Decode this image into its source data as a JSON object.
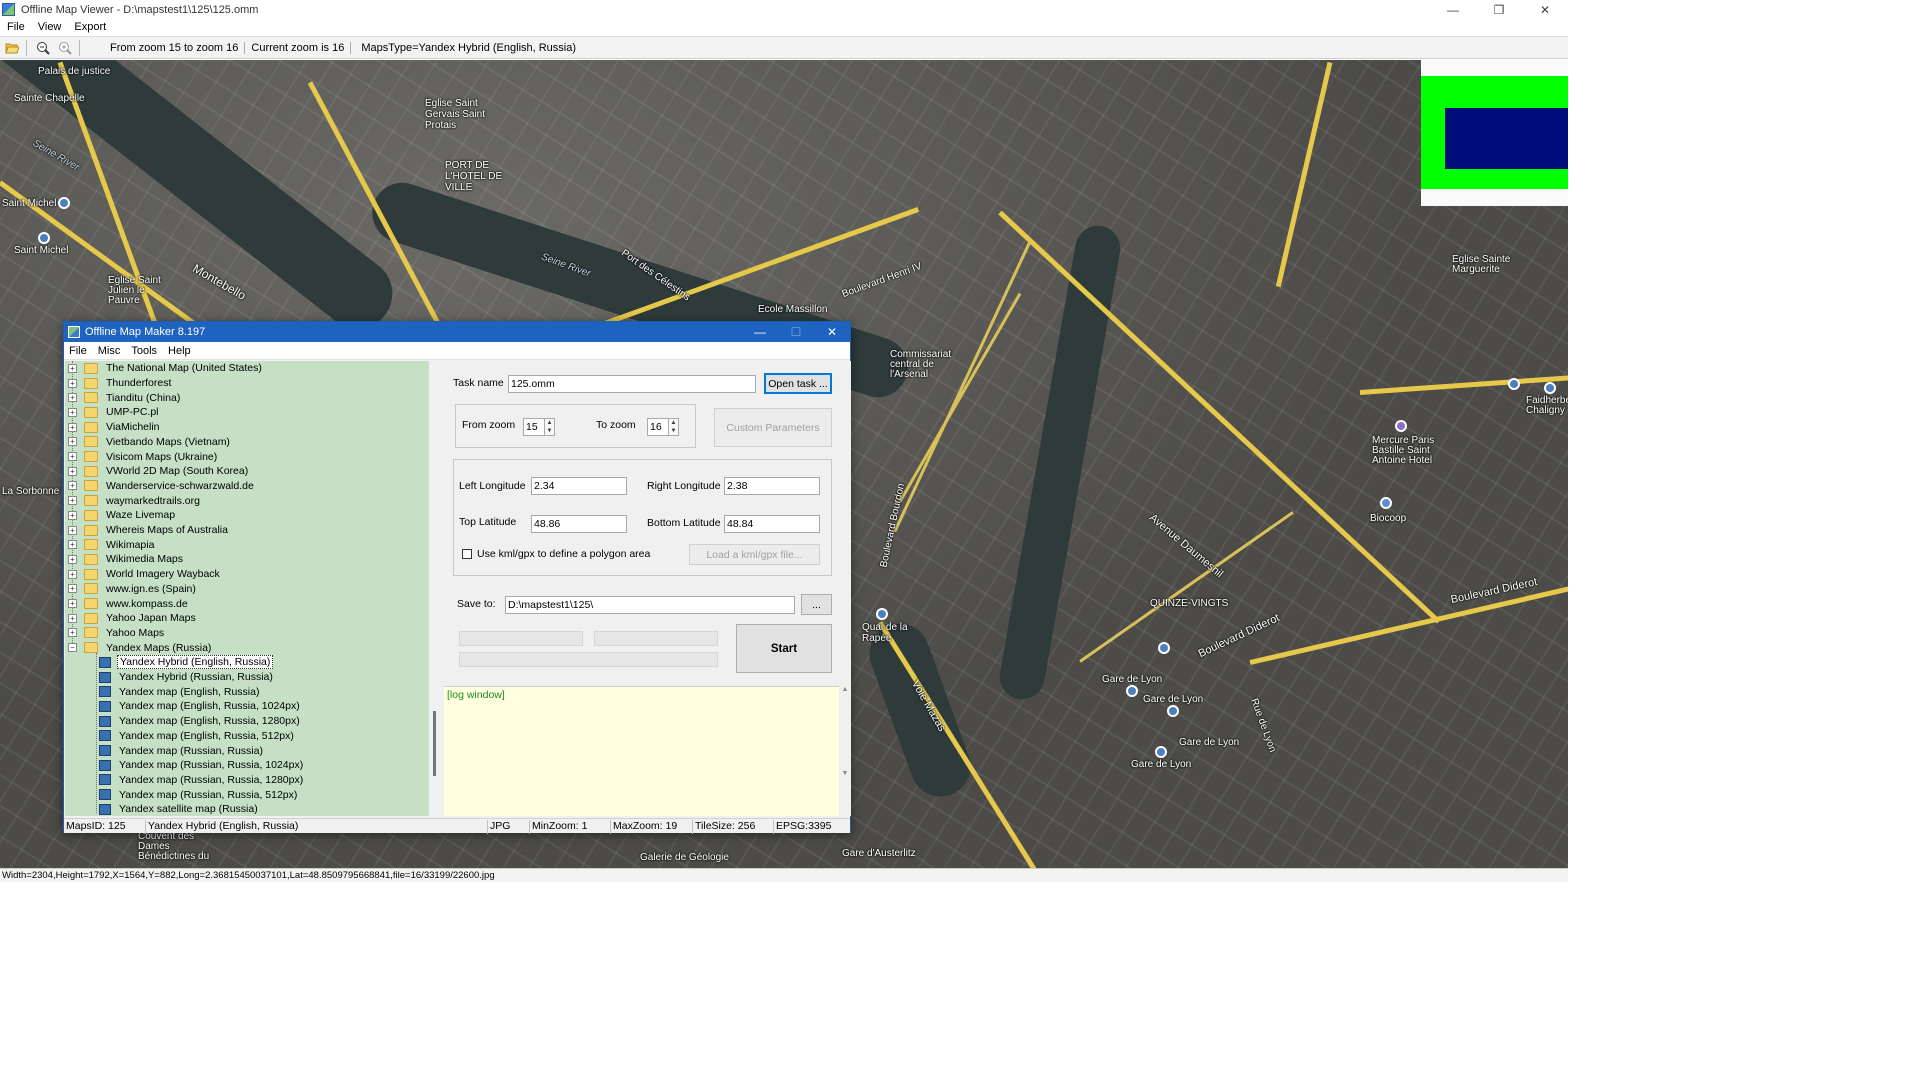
{
  "window": {
    "title": "Offline Map Viewer - D:\\mapstest1\\125\\125.omm",
    "controls": {
      "minimize": "—",
      "maximize": "❐",
      "close": "✕"
    }
  },
  "menu": [
    "File",
    "View",
    "Export"
  ],
  "toolbar": {
    "zoom_range": "From zoom 15 to zoom 16",
    "current_zoom": "Current zoom is 16",
    "maps_type": "MapsType=Yandex Hybrid (English, Russia)"
  },
  "map_labels": [
    "Palais de justice",
    "Sainte Chapelle",
    "Eglise Saint Gervais Saint Protais",
    "PORT DE L'HOTEL DE VILLE",
    "Seine River",
    "Montebello",
    "Saint Michel",
    "Saint Michel",
    "Seine River",
    "Port des Célestins",
    "Boulevard Henri IV",
    "Commissariat central de l'Arsenal",
    "Boulevard Bourdon",
    "Quai de la Rapée",
    "Mercure Paris Bastille Saint Antoine Hotel",
    "Biocoop",
    "Avenue Daumesnil",
    "Boulevard Diderot",
    "Gare de Lyon",
    "Gare de Lyon",
    "Gare de Lyon",
    "Gare de Lyon",
    "Boulevard Diderot",
    "Voie Mazas",
    "Faidherbe Chaligny",
    "La Sorbonne",
    "Eglise Saint Julien le Pauvre",
    "QUINZE-VINGTS",
    "Rue de Lyon",
    "Eglise Sainte Marguerite",
    "Ecole Massillon",
    "Gare d'Austerlitz",
    "Galerie de Géologie",
    "Couvent des Dames Bénédictines du"
  ],
  "statusbar": "Width=2304,Height=1792,X=1564,Y=882,Long=2.36815450037101,Lat=48.8509795668841,file=16/33199/22600.jpg",
  "dialog": {
    "title": "Offline Map Maker 8.197",
    "controls": {
      "minimize": "—",
      "maximize": "☐",
      "close": "✕"
    },
    "menu": [
      "File",
      "Misc",
      "Tools",
      "Help"
    ],
    "tree_folders": [
      "The National Map (United States)",
      "Thunderforest",
      "Tianditu (China)",
      "UMP-PC.pl",
      "ViaMichelin",
      "Vietbando Maps (Vietnam)",
      "Visicom Maps (Ukraine)",
      "VWorld 2D Map (South Korea)",
      "Wanderservice-schwarzwald.de",
      "waymarkedtrails.org",
      "Waze Livemap",
      "Whereis Maps of Australia",
      "Wikimapia",
      "Wikimedia Maps",
      "World Imagery Wayback",
      "www.ign.es (Spain)",
      "www.kompass.de",
      "Yahoo Japan Maps",
      "Yahoo Maps",
      "Yandex Maps (Russia)"
    ],
    "tree_children": [
      "Yandex Hybrid (English, Russia)",
      "Yandex Hybrid (Russian, Russia)",
      "Yandex map (English, Russia)",
      "Yandex map (English, Russia, 1024px)",
      "Yandex map (English, Russia, 1280px)",
      "Yandex map (English, Russia, 512px)",
      "Yandex map (Russian, Russia)",
      "Yandex map (Russian, Russia, 1024px)",
      "Yandex map (Russian, Russia, 1280px)",
      "Yandex map (Russian, Russia, 512px)",
      "Yandex satellite map (Russia)"
    ],
    "task_name_label": "Task name",
    "task_name": "125.omm",
    "open_task": "Open task ...",
    "from_zoom_label": "From zoom",
    "from_zoom": "15",
    "to_zoom_label": "To zoom",
    "to_zoom": "16",
    "custom_params": "Custom Parameters",
    "left_lon_label": "Left Longitude",
    "left_lon": "2.34",
    "right_lon_label": "Right Longitude",
    "right_lon": "2.38",
    "top_lat_label": "Top Latitude",
    "top_lat": "48.86",
    "bottom_lat_label": "Bottom Latitude",
    "bottom_lat": "48.84",
    "kml_label": "Use kml/gpx to define a polygon area",
    "load_kml": "Load a kml/gpx file...",
    "save_to_label": "Save to:",
    "save_to": "D:\\mapstest1\\125\\",
    "browse": "...",
    "start": "Start",
    "log": "[log window]",
    "status": {
      "maps_id": "MapsID: 125",
      "map_name": "Yandex Hybrid (English, Russia)",
      "format": "JPG",
      "min_zoom": "MinZoom: 1",
      "max_zoom": "MaxZoom: 19",
      "tile_size": "TileSize: 256",
      "epsg": "EPSG:3395"
    }
  }
}
